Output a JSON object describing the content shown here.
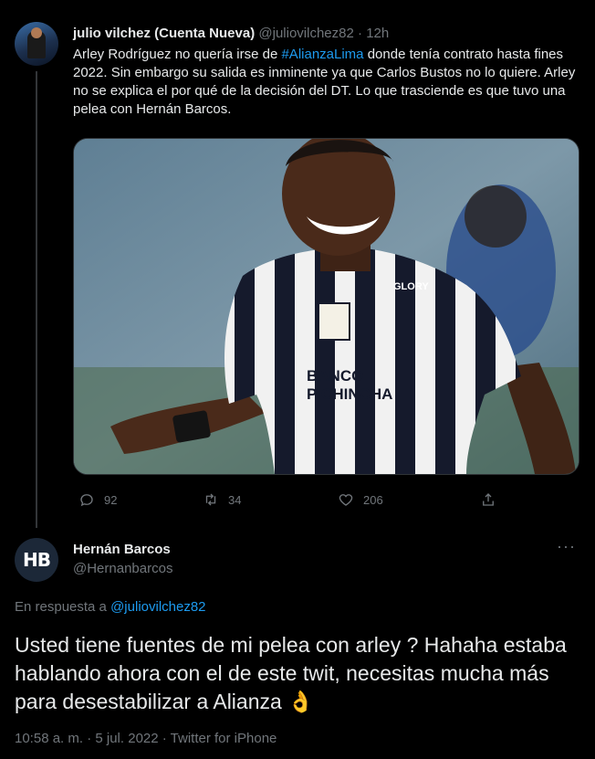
{
  "tweet1": {
    "author_name": "julio vilchez (Cuenta Nueva)",
    "handle": "@juliovilchez82",
    "separator": " · ",
    "time": "12h",
    "text_before": "Arley Rodríguez no quería irse de ",
    "hashtag": "#AlianzaLima",
    "text_after": " donde tenía contrato hasta fines 2022. Sin embargo su salida es inminente ya que Carlos Bustos no lo quiere. Arley no se explica el por qué de la decisión del DT. Lo que trasciende es que tuvo una pelea con Hernán Barcos.",
    "image_sponsor_line1": "BANCO",
    "image_sponsor_line2": "PICHINCHA",
    "image_brand": "GLORY",
    "replies": "92",
    "retweets": "34",
    "likes": "206",
    "more": "···"
  },
  "tweet2": {
    "avatar_text": "HB",
    "author_name": "Hernán Barcos",
    "handle": "@Hernanbarcos",
    "more": "···",
    "reply_prefix": "En respuesta a ",
    "reply_handle": "@juliovilchez82",
    "text": "Usted tiene fuentes de mi pelea con arley ? Hahaha estaba hablando ahora con el de este twit, necesitas mucha más para desestabilizar a Alianza 👌",
    "timestamp": "10:58 a. m. · 5 jul. 2022 · Twitter for iPhone"
  },
  "colors": {
    "background": "#000000",
    "text": "#e7e9ea",
    "muted": "#71767b",
    "link": "#1d9bf0"
  }
}
